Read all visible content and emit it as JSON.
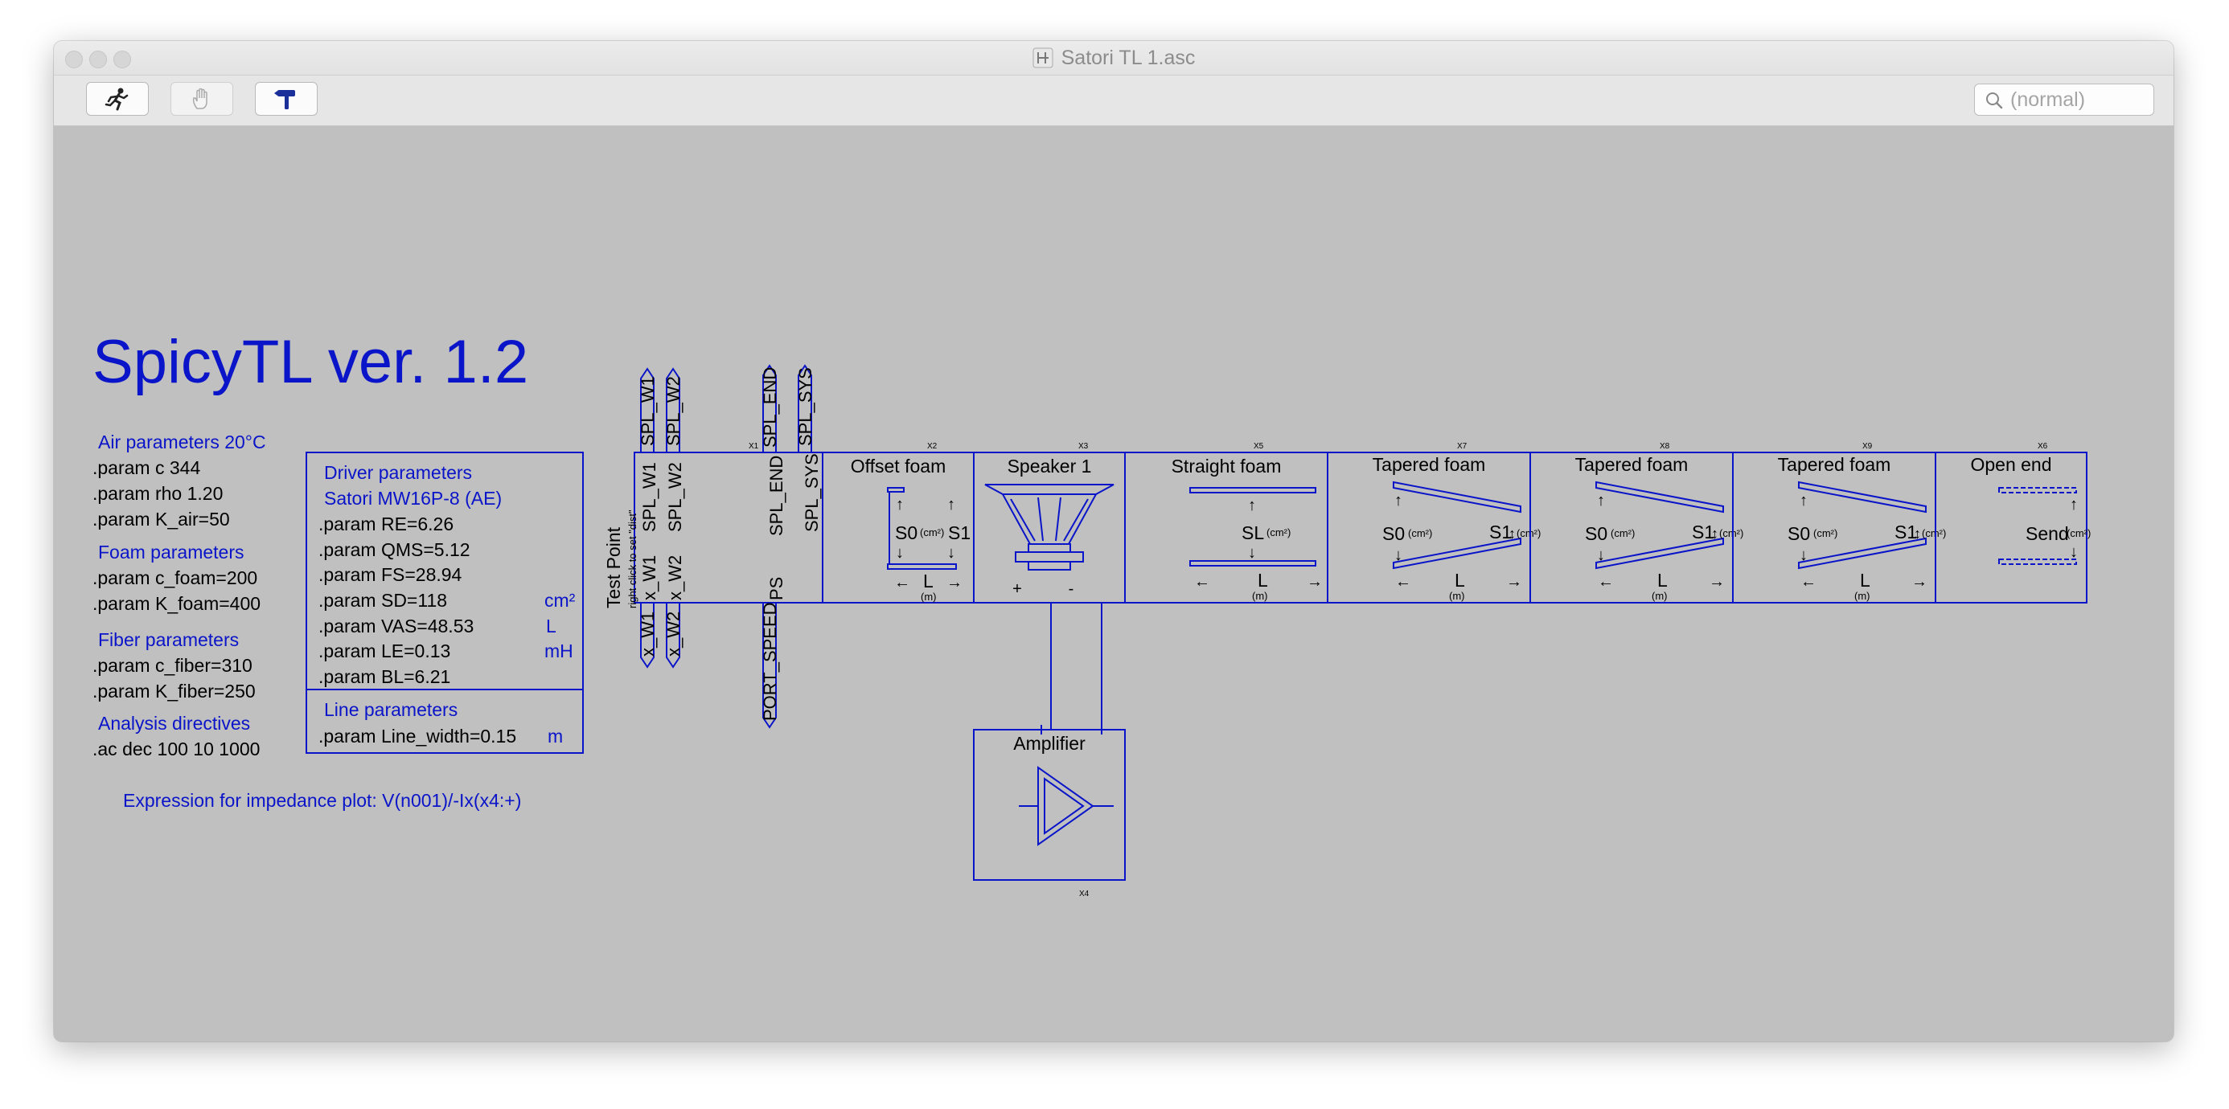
{
  "window": {
    "title": "Satori TL 1.asc"
  },
  "toolbar": {
    "run_icon": "running-man-icon",
    "halt_icon": "hand-icon",
    "hammer_icon": "hammer-icon",
    "search_placeholder": "(normal)"
  },
  "schematic": {
    "title": "SpicyTL ver. 1.2",
    "air": {
      "header": "Air parameters 20°C",
      "lines": [
        ".param c 344",
        ".param rho 1.20",
        ".param K_air=50"
      ]
    },
    "foam": {
      "header": "Foam parameters",
      "lines": [
        ".param c_foam=200",
        ".param K_foam=400"
      ]
    },
    "fiber": {
      "header": "Fiber parameters",
      "lines": [
        ".param c_fiber=310",
        ".param K_fiber=250"
      ]
    },
    "analysis": {
      "header": "Analysis directives",
      "lines": [
        ".ac dec 100 10 1000"
      ]
    },
    "impedance_expr": "Expression for impedance plot: V(n001)/-Ix(x4:+)",
    "driver": {
      "header": "Driver parameters",
      "model": "Satori MW16P-8 (AE)",
      "params": [
        ".param RE=6.26",
        ".param QMS=5.12",
        ".param FS=28.94",
        ".param SD=118",
        ".param VAS=48.53",
        ".param LE=0.13",
        ".param BL=6.21"
      ],
      "units": {
        "sd": "cm²",
        "vas": "L",
        "le": "mH"
      }
    },
    "line": {
      "header": "Line parameters",
      "param": ".param Line_width=0.15",
      "unit": "m"
    },
    "testpoint": {
      "title": "Test Point",
      "subtitle": "right click to set \"dist\"",
      "pins_inner": [
        "SPL_W1",
        "SPL_W2",
        "x_W1",
        "x_W2"
      ],
      "pin_sp_end": "SPL_END",
      "pin_sp_sys": "SPL_SYS",
      "pin_ps": "PS",
      "flags_top": [
        "SPL_W1",
        "SPL_W2",
        "SPL_END",
        "SPL_SYS"
      ],
      "flags_bottom": [
        "x_W1",
        "x_W2",
        "PORT_SPEED"
      ],
      "ref": "X1"
    },
    "blocks": {
      "offset": {
        "title": "Offset foam",
        "ref": "X2"
      },
      "speaker": {
        "title": "Speaker 1",
        "ref": "X3",
        "plus": "+",
        "minus": "-"
      },
      "straight": {
        "title": "Straight foam",
        "ref": "X5"
      },
      "tap1": {
        "title": "Tapered foam",
        "ref": "X7"
      },
      "tap2": {
        "title": "Tapered foam",
        "ref": "X8"
      },
      "tap3": {
        "title": "Tapered foam",
        "ref": "X9"
      },
      "openend": {
        "title": "Open end",
        "ref": "X6"
      },
      "amp": {
        "title": "Amplifier",
        "ref": "X4"
      }
    },
    "sym": {
      "s0": "S0",
      "s1": "S1",
      "sl": "SL",
      "send": "Send",
      "l": "L",
      "cm2": "(cm²)",
      "m": "(m)",
      "arrow_up": "↑",
      "arrow_down": "↓",
      "arrow_left": "←",
      "arrow_right": "→",
      "updown": "↕"
    }
  },
  "colors": {
    "schematic_blue": "#0a14c8",
    "canvas": "#c0c0c0"
  }
}
